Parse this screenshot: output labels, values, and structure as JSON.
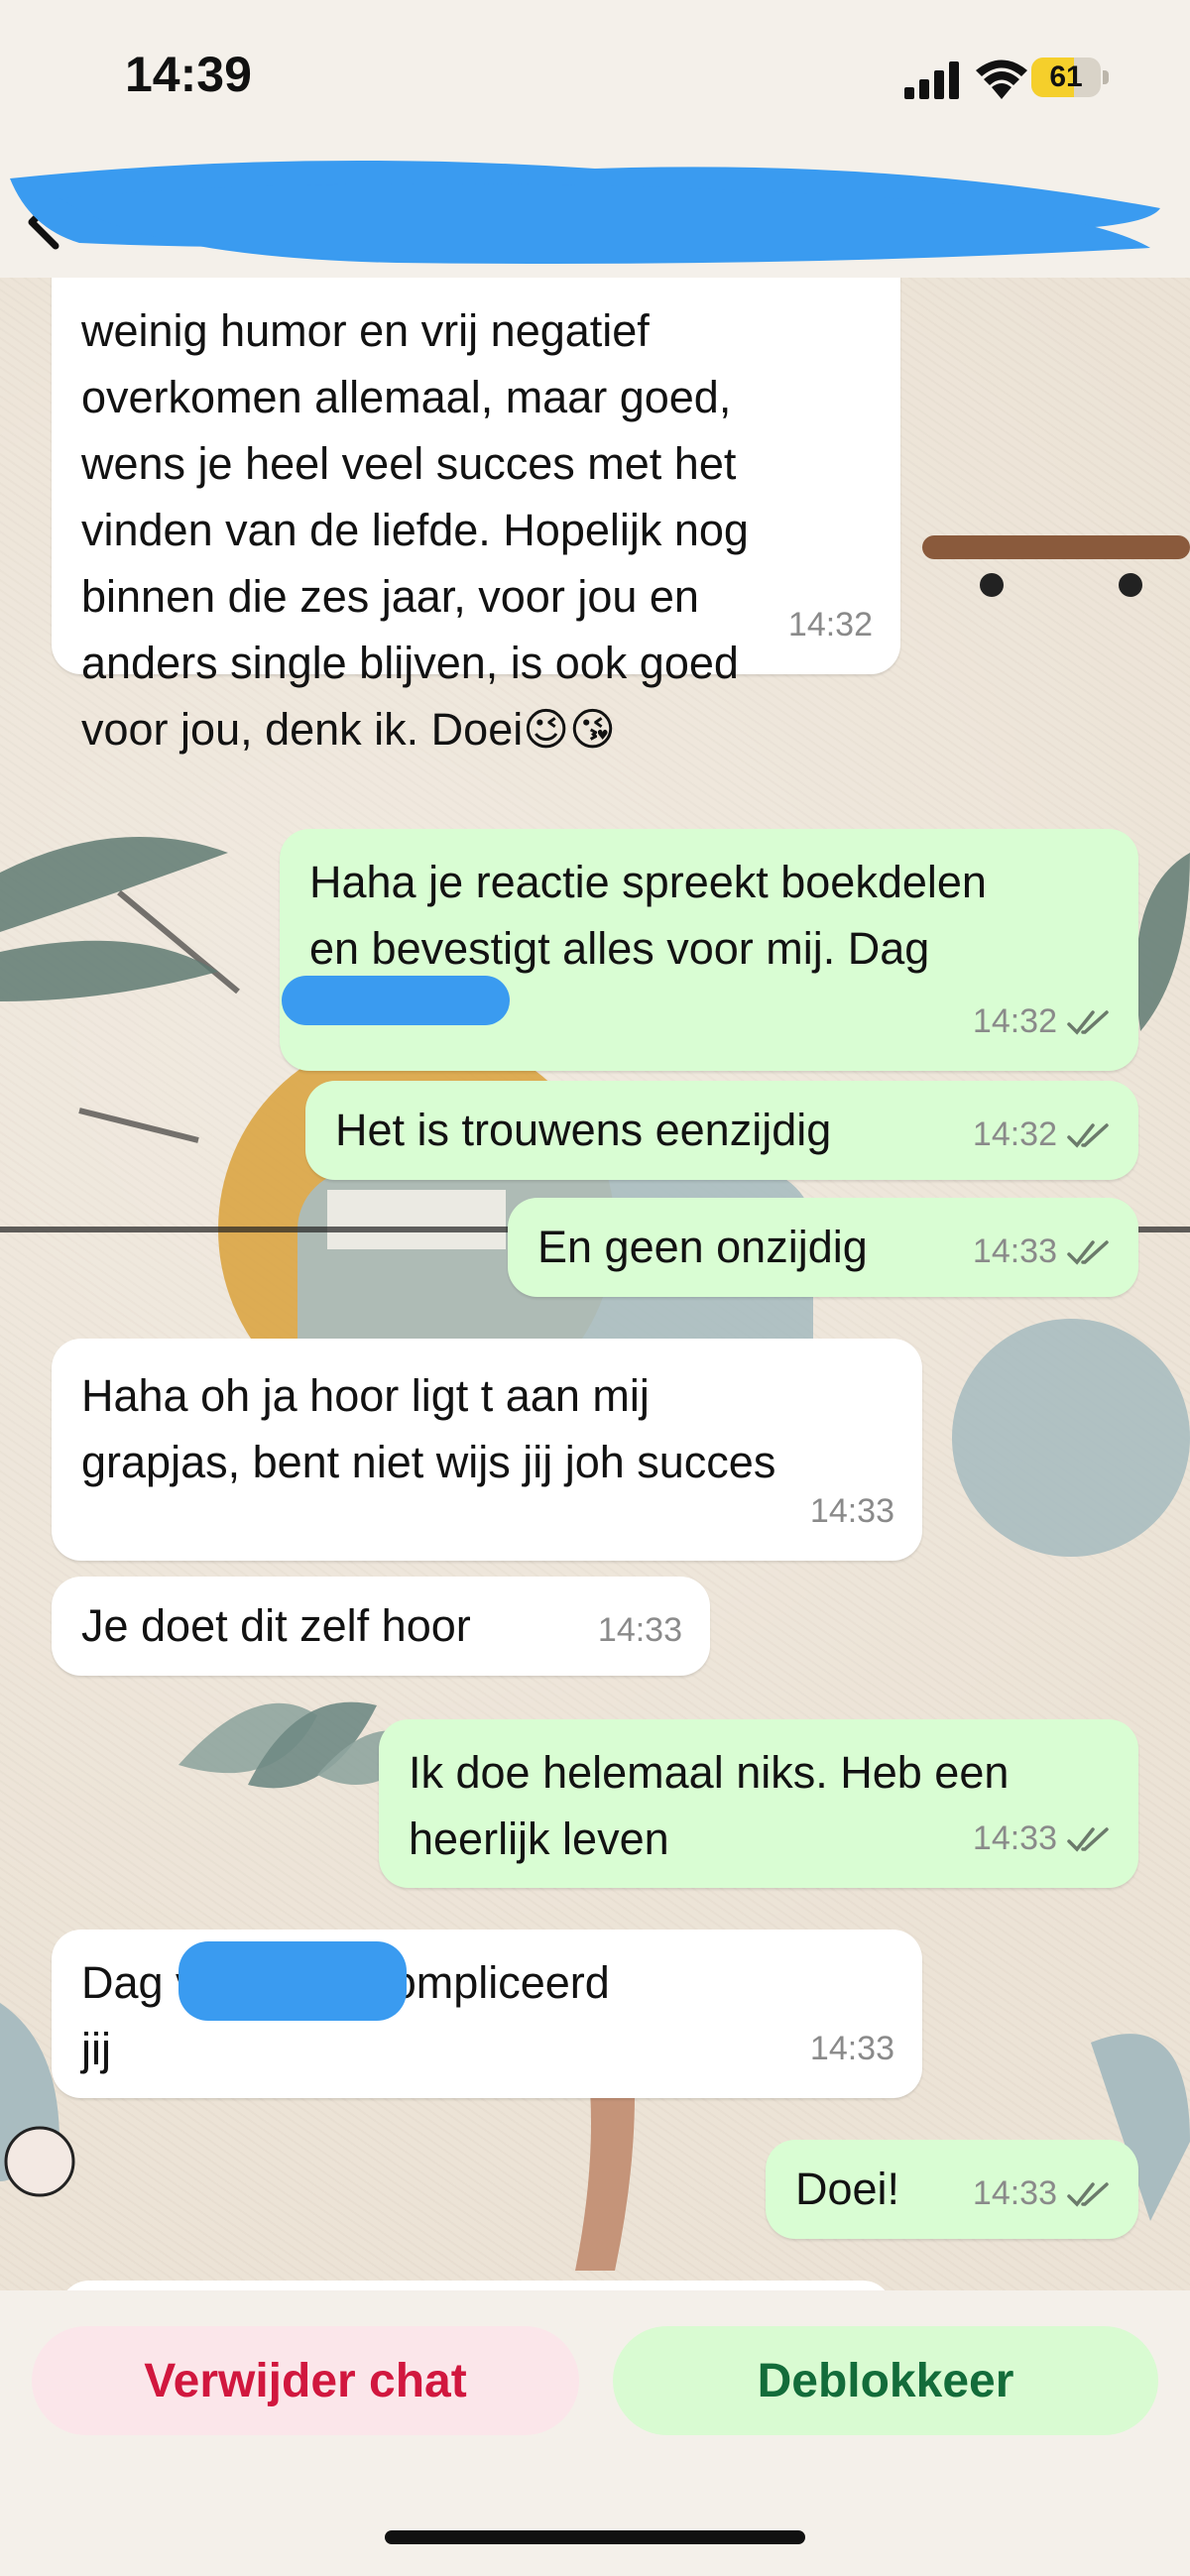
{
  "status_bar": {
    "time": "14:39",
    "battery_level": "61",
    "battery_fraction": 0.61,
    "icons": [
      "signal-icon",
      "wifi-icon",
      "battery-icon"
    ]
  },
  "header": {
    "back_icon": "chevron-left-icon"
  },
  "messages": [
    {
      "dir": "in",
      "text": "weinig humor en vrij negatief\noverkomen allemaal, maar goed,\nwens je heel veel succes met het\nvinden van de liefde. Hopelijk nog\nbinnen die zes jaar, voor jou en\nanders single blijven, is ook goed\nvoor jou, denk ik. Doei😉😘",
      "time": "14:32"
    },
    {
      "dir": "out",
      "text": "Haha je reactie spreekt boekdelen\nen bevestigt alles voor mij. Dag",
      "time": "14:32",
      "status": "read"
    },
    {
      "dir": "out",
      "text": "Het is trouwens eenzijdig",
      "time": "14:32",
      "status": "read"
    },
    {
      "dir": "out",
      "text": "En geen onzijdig",
      "time": "14:33",
      "status": "read"
    },
    {
      "dir": "in",
      "text": "Haha oh ja hoor ligt t aan mij\ngrapjas, bent niet wijs jij joh succes",
      "time": "14:33"
    },
    {
      "dir": "in",
      "text": "Je doet dit zelf hoor",
      "time": "14:33"
    },
    {
      "dir": "out",
      "text": "Ik doe helemaal niks. Heb een\nheerlijk leven",
      "time": "14:33",
      "status": "read"
    },
    {
      "dir": "in",
      "text": "Dag                veel te gecompliceerd\njij",
      "time": "14:33"
    },
    {
      "dir": "out",
      "text": "Doei!",
      "time": "14:33",
      "status": "read"
    }
  ],
  "actions": {
    "delete_label": "Verwijder chat",
    "unblock_label": "Deblokkeer"
  },
  "colors": {
    "incoming": "#ffffff",
    "outgoing": "#d9fdd3",
    "redaction": "#3a9bf0",
    "delete": "#d1173e",
    "unblock": "#136c3a"
  }
}
